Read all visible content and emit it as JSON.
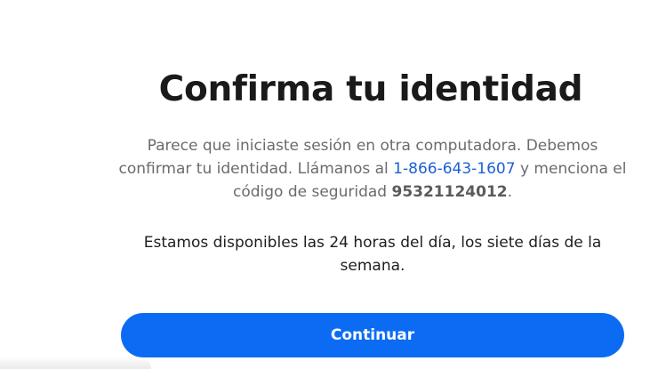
{
  "title": "Confirma tu identidad",
  "message": {
    "part1": "Parece que iniciaste sesión en otra computadora. Debemos confirmar tu identidad. Llámanos al ",
    "phone": "1-866-643-1607",
    "part2": " y menciona el código de seguridad ",
    "code": "95321124012",
    "part3": "."
  },
  "availability": "Estamos disponibles las 24 horas del día, los siete días de la semana.",
  "continue_label": "Continuar",
  "colors": {
    "accent": "#0b6cf3",
    "link": "#1c5fd6",
    "title": "#1a1a1a",
    "muted_text": "#6b6b6b"
  }
}
